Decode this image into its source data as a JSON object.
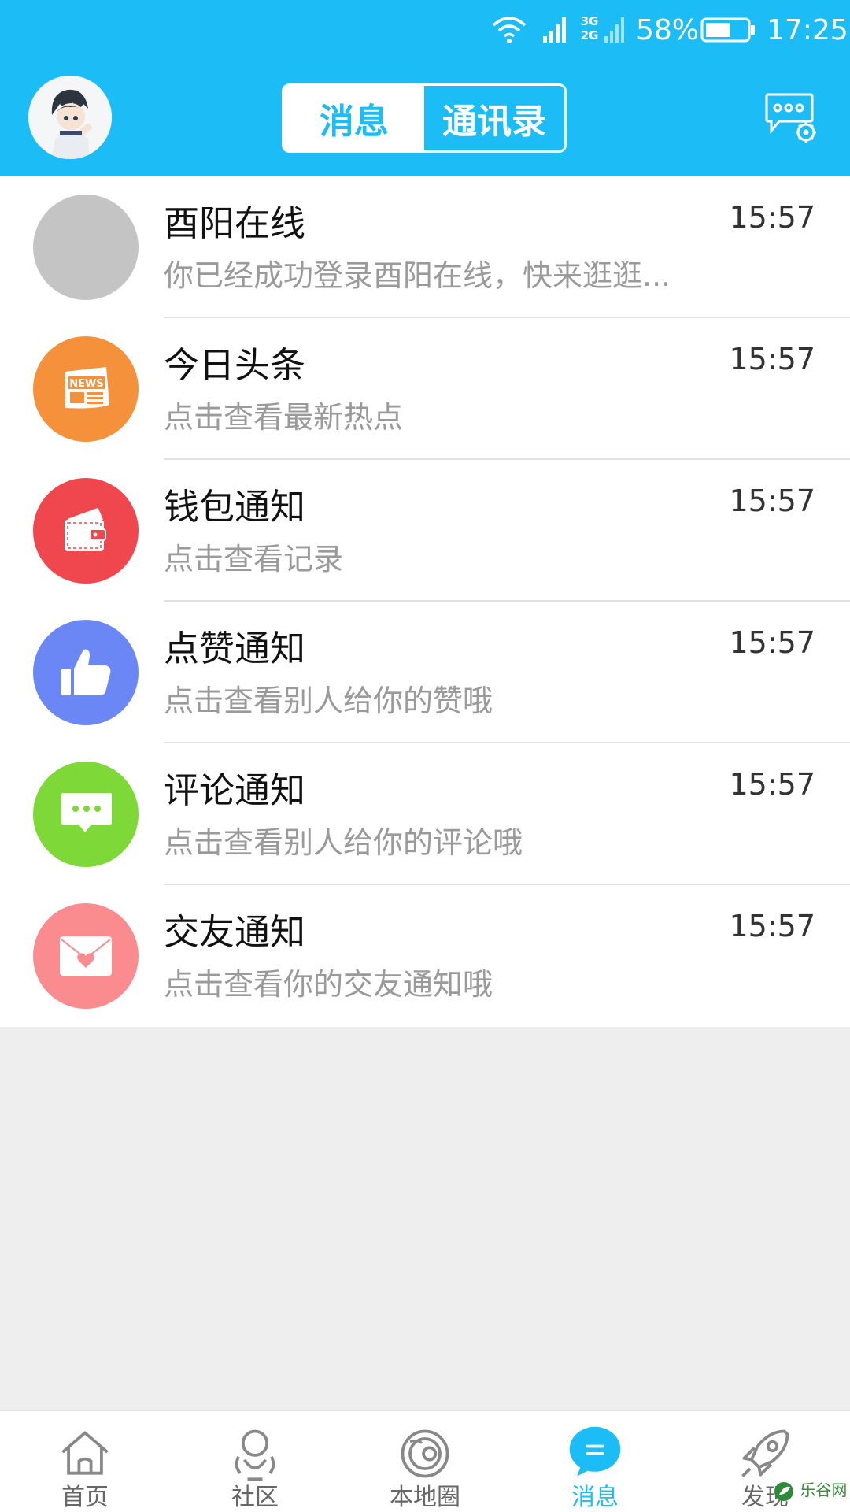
{
  "status_bar": {
    "battery_pct": "58%",
    "time": "17:25",
    "net_type_top": "3G",
    "net_type_bottom": "2G"
  },
  "header": {
    "tabs": [
      {
        "label": "消息",
        "active": true
      },
      {
        "label": "通讯录",
        "active": false
      }
    ]
  },
  "messages": [
    {
      "title": "酉阳在线",
      "preview": "你已经成功登录酉阳在线，快来逛逛...",
      "time": "15:57",
      "icon": "placeholder-avatar",
      "color": "#c4c4c4"
    },
    {
      "title": "今日头条",
      "preview": "点击查看最新热点",
      "time": "15:57",
      "icon": "news-icon",
      "color": "#f5903b"
    },
    {
      "title": "钱包通知",
      "preview": "点击查看记录",
      "time": "15:57",
      "icon": "wallet-icon",
      "color": "#f0474f"
    },
    {
      "title": "点赞通知",
      "preview": "点击查看别人给你的赞哦",
      "time": "15:57",
      "icon": "thumbs-up-icon",
      "color": "#6b87f5"
    },
    {
      "title": "评论通知",
      "preview": "点击查看别人给你的评论哦",
      "time": "15:57",
      "icon": "comment-icon",
      "color": "#7ed838"
    },
    {
      "title": "交友通知",
      "preview": "点击查看你的交友通知哦",
      "time": "15:57",
      "icon": "heart-envelope-icon",
      "color": "#fa8c8f"
    }
  ],
  "bottom_nav": [
    {
      "label": "首页",
      "icon": "home-icon",
      "active": false
    },
    {
      "label": "社区",
      "icon": "community-icon",
      "active": false
    },
    {
      "label": "本地圈",
      "icon": "planet-icon",
      "active": false
    },
    {
      "label": "消息",
      "icon": "message-icon",
      "active": true
    },
    {
      "label": "发现",
      "icon": "rocket-icon",
      "active": false
    }
  ],
  "watermark": "乐谷网",
  "colors": {
    "accent": "#1cbdf6",
    "background": "#eeeeee"
  }
}
